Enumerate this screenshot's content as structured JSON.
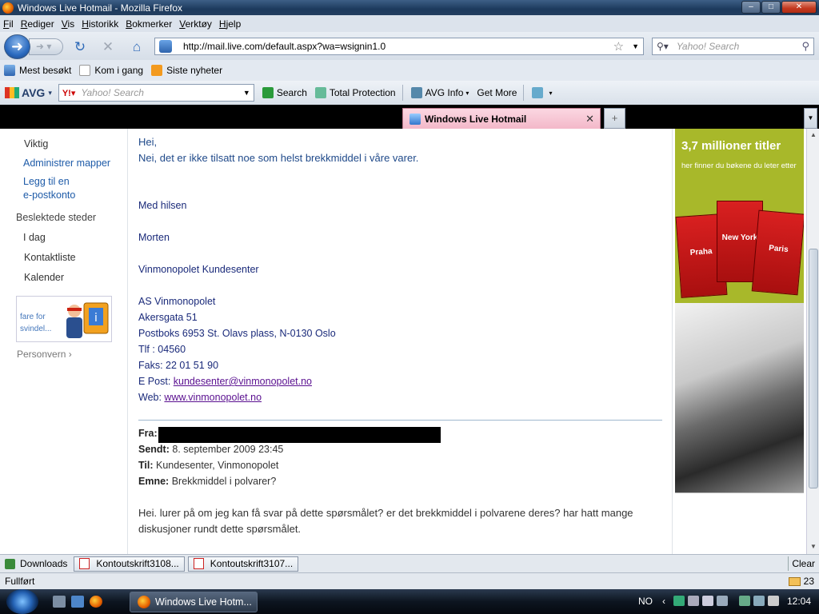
{
  "window": {
    "title": "Windows Live Hotmail - Mozilla Firefox"
  },
  "menu": [
    "Fil",
    "Rediger",
    "Vis",
    "Historikk",
    "Bokmerker",
    "Verktøy",
    "Hjelp"
  ],
  "nav": {
    "url": "http://mail.live.com/default.aspx?wa=wsignin1.0",
    "search_placeholder": "Yahoo! Search"
  },
  "bookmarks": [
    "Mest besøkt",
    "Kom i gang",
    "Siste nyheter"
  ],
  "avg": {
    "logo": "AVG",
    "search_placeholder": "Yahoo! Search",
    "search_label": "Search",
    "total_protection": "Total Protection",
    "avg_info": "AVG Info",
    "get_more": "Get More"
  },
  "tab": {
    "title": "Windows Live Hotmail"
  },
  "sidebar": {
    "viktig": "Viktig",
    "administrer": "Administrer mapper",
    "legg_til_1": "Legg til en",
    "legg_til_2": "e-postkonto",
    "related_heading": "Beslektede steder",
    "i_dag": "I dag",
    "kontaktliste": "Kontaktliste",
    "kalender": "Kalender",
    "fraud_ad_1": "fare for",
    "fraud_ad_2": "svindel...",
    "privacy": "Personvern"
  },
  "message": {
    "greeting": "Hei,",
    "reply": "Nei, det er ikke tilsatt noe som helst brekkmiddel i våre varer.",
    "regards": "Med hilsen",
    "name": "Morten",
    "dept": "Vinmonopolet Kundesenter",
    "company": "AS Vinmonopolet",
    "street": "Akersgata 51",
    "postbox": "Postboks 6953 St. Olavs plass, N-0130 Oslo",
    "phone": "Tlf : 04560",
    "fax": "Faks: 22 01 51 90",
    "email_label": "E Post: ",
    "email": "kundesenter@vinmonopolet.no",
    "web_label": "Web: ",
    "web": "www.vinmonopolet.no",
    "from_label": "Fra:",
    "sent_label": "Sendt:",
    "sent": "8. september 2009 23:45",
    "to_label": "Til:",
    "to": "Kundesenter, Vinmonopolet",
    "subject_label": "Emne:",
    "subject": "Brekkmiddel i polvarer?",
    "quoted": "Hei. lurer på om jeg kan få svar på dette spørsmålet? er det brekkmiddel i polvarene deres? har hatt mange diskusjoner rundt dette spørsmålet."
  },
  "ad": {
    "headline": "3,7 millioner titler",
    "sub": "her finner du bøkene du leter etter",
    "books": [
      "Praha",
      "New York",
      "Paris"
    ]
  },
  "downloads": {
    "label": "Downloads",
    "files": [
      "Kontoutskrift3108...",
      "Kontoutskrift3107..."
    ],
    "clear": "Clear"
  },
  "status": {
    "text": "Fullført",
    "mail_count": "23"
  },
  "taskbar": {
    "task": "Windows Live Hotm...",
    "lang": "NO",
    "clock": "12:04"
  }
}
